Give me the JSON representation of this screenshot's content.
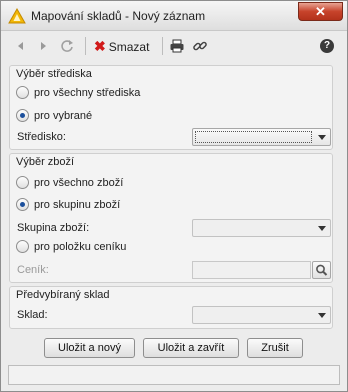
{
  "window": {
    "title": "Mapování skladů - Nový záznam",
    "close_label": "✕"
  },
  "toolbar": {
    "delete_label": "Smazat"
  },
  "centers": {
    "title": "Výběr střediska",
    "option_all": "pro všechny střediska",
    "option_selected": "pro vybrané",
    "field_label": "Středisko:",
    "value": ""
  },
  "goods": {
    "title": "Výběr zboží",
    "option_all": "pro všechno zboží",
    "option_group": "pro skupinu zboží",
    "group_label": "Skupina zboží:",
    "group_value": "",
    "option_item": "pro položku ceníku",
    "pricelist_label": "Ceník:",
    "pricelist_value": ""
  },
  "warehouse": {
    "title": "Předvybíraný sklad",
    "field_label": "Sklad:",
    "value": ""
  },
  "buttons": {
    "save_new": "Uložit a nový",
    "save_close": "Uložit a zavřít",
    "cancel": "Zrušit"
  }
}
